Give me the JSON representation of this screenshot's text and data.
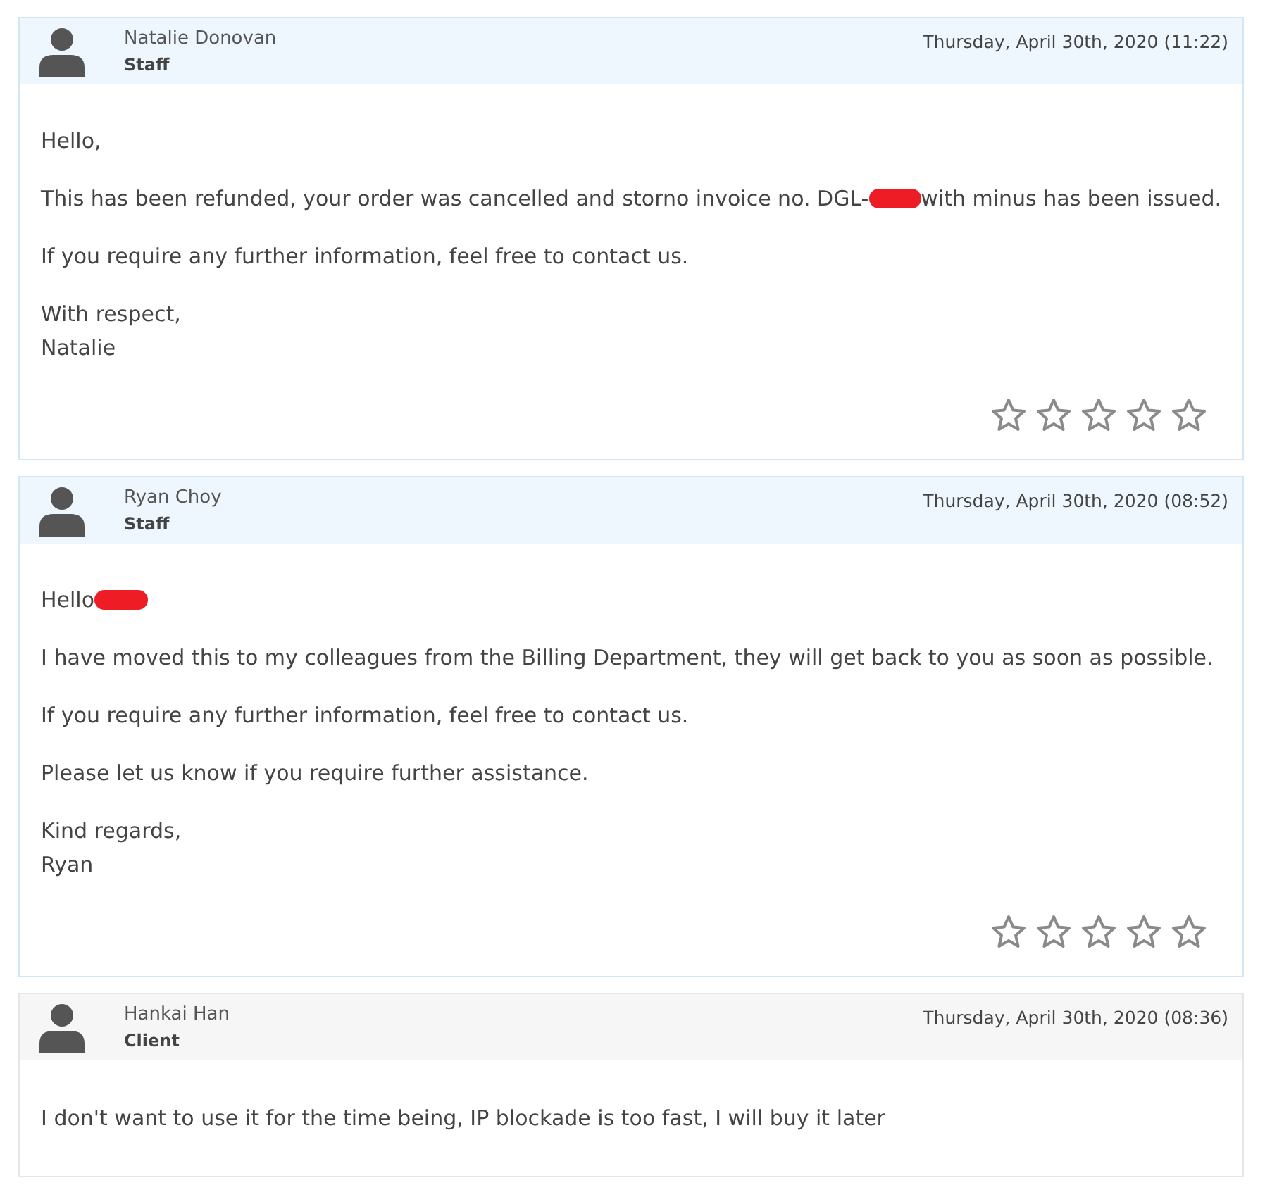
{
  "replies": [
    {
      "author": "Natalie Donovan",
      "role": "Staff",
      "kind": "staff",
      "date": "Thursday, April 30th, 2020 (11:22)",
      "stars": 0,
      "paragraphs": [
        {
          "lines": [
            [
              {
                "kind": "text",
                "text": "Hello,"
              }
            ]
          ]
        },
        {
          "lines": [
            [
              {
                "kind": "text",
                "text": "This has been refunded, your order was cancelled and storno invoice no. DGL-"
              },
              {
                "kind": "redaction"
              },
              {
                "kind": "text",
                "text": "with minus has been issued."
              }
            ]
          ]
        },
        {
          "lines": [
            [
              {
                "kind": "text",
                "text": "If you require any further information, feel free to contact us."
              }
            ]
          ]
        },
        {
          "lines": [
            [
              {
                "kind": "text",
                "text": "With respect,"
              }
            ],
            [
              {
                "kind": "text",
                "text": "Natalie"
              }
            ]
          ]
        }
      ]
    },
    {
      "author": "Ryan Choy",
      "role": "Staff",
      "kind": "staff",
      "date": "Thursday, April 30th, 2020 (08:52)",
      "stars": 0,
      "paragraphs": [
        {
          "lines": [
            [
              {
                "kind": "text",
                "text": "Hello"
              },
              {
                "kind": "redaction"
              }
            ]
          ]
        },
        {
          "lines": [
            [
              {
                "kind": "text",
                "text": "I have moved this to my colleagues from the Billing Department, they will get back to you as soon as possible."
              }
            ]
          ]
        },
        {
          "lines": [
            [
              {
                "kind": "text",
                "text": "If you require any further information, feel free to contact us."
              }
            ]
          ]
        },
        {
          "lines": [
            [
              {
                "kind": "text",
                "text": "Please let us know if you require further assistance."
              }
            ]
          ]
        },
        {
          "lines": [
            [
              {
                "kind": "text",
                "text": "Kind regards,"
              }
            ],
            [
              {
                "kind": "text",
                "text": "Ryan"
              }
            ]
          ]
        }
      ]
    },
    {
      "author": "Hankai Han",
      "role": "Client",
      "kind": "client",
      "date": "Thursday, April 30th, 2020 (08:36)",
      "paragraphs": [
        {
          "lines": [
            [
              {
                "kind": "text",
                "text": "I don't want to use it for the time being, IP blockade is too fast, I will buy it later"
              }
            ]
          ]
        }
      ]
    }
  ]
}
